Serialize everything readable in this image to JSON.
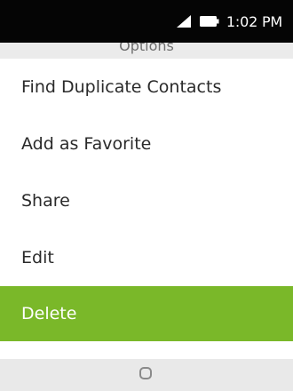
{
  "status_bar": {
    "time": "1:02 PM",
    "signal_icon": "signal-icon",
    "battery_icon": "battery-icon"
  },
  "header": {
    "title": "Options"
  },
  "menu": {
    "items": [
      {
        "label": "Find Duplicate Contacts",
        "selected": false
      },
      {
        "label": "Add as Favorite",
        "selected": false
      },
      {
        "label": "Share",
        "selected": false
      },
      {
        "label": "Edit",
        "selected": false
      },
      {
        "label": "Delete",
        "selected": true
      }
    ]
  },
  "nav_bar": {
    "home_icon": "home-circle-icon"
  },
  "colors": {
    "accent": "#7ab829",
    "status_bar": "#050505",
    "nav_bar": "#e9e9e9"
  }
}
